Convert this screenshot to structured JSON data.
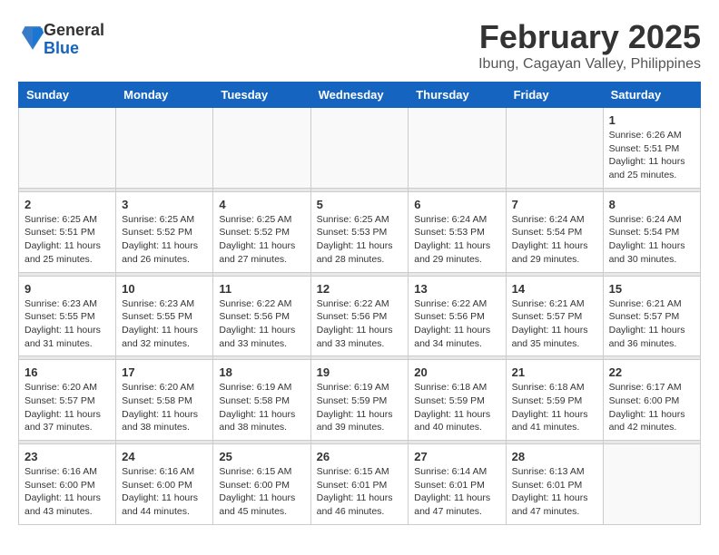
{
  "header": {
    "logo_general": "General",
    "logo_blue": "Blue",
    "main_title": "February 2025",
    "sub_title": "Ibung, Cagayan Valley, Philippines"
  },
  "weekdays": [
    "Sunday",
    "Monday",
    "Tuesday",
    "Wednesday",
    "Thursday",
    "Friday",
    "Saturday"
  ],
  "weeks": [
    [
      {
        "day": "",
        "info": ""
      },
      {
        "day": "",
        "info": ""
      },
      {
        "day": "",
        "info": ""
      },
      {
        "day": "",
        "info": ""
      },
      {
        "day": "",
        "info": ""
      },
      {
        "day": "",
        "info": ""
      },
      {
        "day": "1",
        "info": "Sunrise: 6:26 AM\nSunset: 5:51 PM\nDaylight: 11 hours and 25 minutes."
      }
    ],
    [
      {
        "day": "2",
        "info": "Sunrise: 6:25 AM\nSunset: 5:51 PM\nDaylight: 11 hours and 25 minutes."
      },
      {
        "day": "3",
        "info": "Sunrise: 6:25 AM\nSunset: 5:52 PM\nDaylight: 11 hours and 26 minutes."
      },
      {
        "day": "4",
        "info": "Sunrise: 6:25 AM\nSunset: 5:52 PM\nDaylight: 11 hours and 27 minutes."
      },
      {
        "day": "5",
        "info": "Sunrise: 6:25 AM\nSunset: 5:53 PM\nDaylight: 11 hours and 28 minutes."
      },
      {
        "day": "6",
        "info": "Sunrise: 6:24 AM\nSunset: 5:53 PM\nDaylight: 11 hours and 29 minutes."
      },
      {
        "day": "7",
        "info": "Sunrise: 6:24 AM\nSunset: 5:54 PM\nDaylight: 11 hours and 29 minutes."
      },
      {
        "day": "8",
        "info": "Sunrise: 6:24 AM\nSunset: 5:54 PM\nDaylight: 11 hours and 30 minutes."
      }
    ],
    [
      {
        "day": "9",
        "info": "Sunrise: 6:23 AM\nSunset: 5:55 PM\nDaylight: 11 hours and 31 minutes."
      },
      {
        "day": "10",
        "info": "Sunrise: 6:23 AM\nSunset: 5:55 PM\nDaylight: 11 hours and 32 minutes."
      },
      {
        "day": "11",
        "info": "Sunrise: 6:22 AM\nSunset: 5:56 PM\nDaylight: 11 hours and 33 minutes."
      },
      {
        "day": "12",
        "info": "Sunrise: 6:22 AM\nSunset: 5:56 PM\nDaylight: 11 hours and 33 minutes."
      },
      {
        "day": "13",
        "info": "Sunrise: 6:22 AM\nSunset: 5:56 PM\nDaylight: 11 hours and 34 minutes."
      },
      {
        "day": "14",
        "info": "Sunrise: 6:21 AM\nSunset: 5:57 PM\nDaylight: 11 hours and 35 minutes."
      },
      {
        "day": "15",
        "info": "Sunrise: 6:21 AM\nSunset: 5:57 PM\nDaylight: 11 hours and 36 minutes."
      }
    ],
    [
      {
        "day": "16",
        "info": "Sunrise: 6:20 AM\nSunset: 5:57 PM\nDaylight: 11 hours and 37 minutes."
      },
      {
        "day": "17",
        "info": "Sunrise: 6:20 AM\nSunset: 5:58 PM\nDaylight: 11 hours and 38 minutes."
      },
      {
        "day": "18",
        "info": "Sunrise: 6:19 AM\nSunset: 5:58 PM\nDaylight: 11 hours and 38 minutes."
      },
      {
        "day": "19",
        "info": "Sunrise: 6:19 AM\nSunset: 5:59 PM\nDaylight: 11 hours and 39 minutes."
      },
      {
        "day": "20",
        "info": "Sunrise: 6:18 AM\nSunset: 5:59 PM\nDaylight: 11 hours and 40 minutes."
      },
      {
        "day": "21",
        "info": "Sunrise: 6:18 AM\nSunset: 5:59 PM\nDaylight: 11 hours and 41 minutes."
      },
      {
        "day": "22",
        "info": "Sunrise: 6:17 AM\nSunset: 6:00 PM\nDaylight: 11 hours and 42 minutes."
      }
    ],
    [
      {
        "day": "23",
        "info": "Sunrise: 6:16 AM\nSunset: 6:00 PM\nDaylight: 11 hours and 43 minutes."
      },
      {
        "day": "24",
        "info": "Sunrise: 6:16 AM\nSunset: 6:00 PM\nDaylight: 11 hours and 44 minutes."
      },
      {
        "day": "25",
        "info": "Sunrise: 6:15 AM\nSunset: 6:00 PM\nDaylight: 11 hours and 45 minutes."
      },
      {
        "day": "26",
        "info": "Sunrise: 6:15 AM\nSunset: 6:01 PM\nDaylight: 11 hours and 46 minutes."
      },
      {
        "day": "27",
        "info": "Sunrise: 6:14 AM\nSunset: 6:01 PM\nDaylight: 11 hours and 47 minutes."
      },
      {
        "day": "28",
        "info": "Sunrise: 6:13 AM\nSunset: 6:01 PM\nDaylight: 11 hours and 47 minutes."
      },
      {
        "day": "",
        "info": ""
      }
    ]
  ]
}
